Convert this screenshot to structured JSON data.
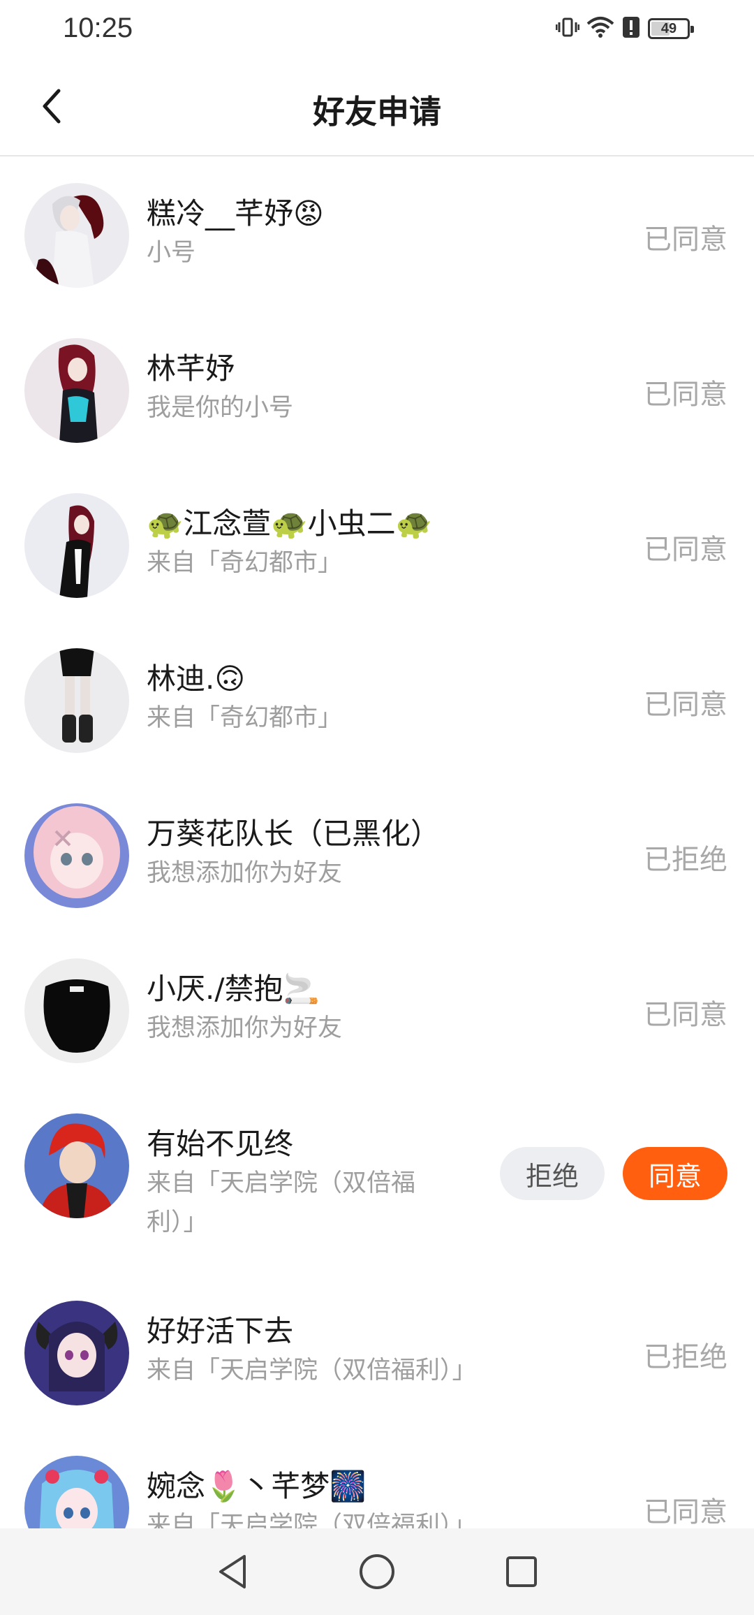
{
  "status_bar": {
    "time": "10:25",
    "battery": "49",
    "battery_level": 0.49,
    "icons": [
      "vibrate-icon",
      "wifi-icon",
      "alert-icon",
      "battery-icon"
    ]
  },
  "header": {
    "title": "好友申请",
    "back_icon": "chevron-left-icon"
  },
  "requests": [
    {
      "name": "糕冷__芊妤😡",
      "sub": "小号",
      "status": "已同意"
    },
    {
      "name": "林芊妤",
      "sub": "我是你的小号",
      "status": "已同意"
    },
    {
      "name": "🐢江念萱🐢小虫二🐢",
      "sub": "来自「奇幻都市」",
      "status": "已同意"
    },
    {
      "name": "林迪.🙃",
      "sub": "来自「奇幻都市」",
      "status": "已同意"
    },
    {
      "name": "万葵花队长（已黑化）",
      "sub": "我想添加你为好友",
      "status": "已拒绝"
    },
    {
      "name": "小厌./禁抱🚬",
      "sub": "我想添加你为好友",
      "status": "已同意"
    },
    {
      "name": "有始不见终",
      "sub": "来自「天启学院（双倍福利）」",
      "reject_label": "拒绝",
      "accept_label": "同意"
    },
    {
      "name": "好好活下去",
      "sub": "来自「天启学院（双倍福利）」",
      "status": "已拒绝"
    },
    {
      "name": "婉念🌷丶芊梦🎆",
      "sub": "来自「天启学院（双倍福利）」",
      "status": "已同意"
    }
  ],
  "colors": {
    "accent": "#ff5f0f",
    "status_text": "#a8a8a8",
    "sub_text": "#9e9e9e"
  },
  "nav_bar": {
    "icons": [
      "back-triangle-icon",
      "home-circle-icon",
      "recents-square-icon"
    ]
  }
}
